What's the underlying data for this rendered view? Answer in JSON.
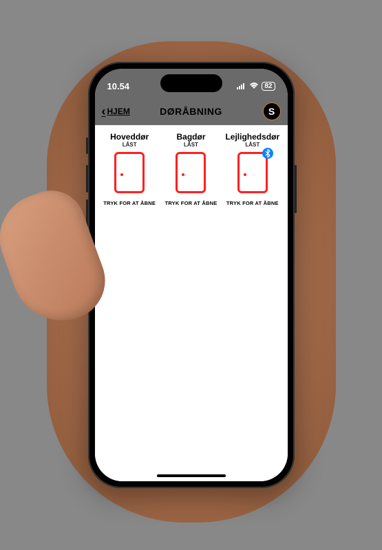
{
  "statusBar": {
    "time": "10.54",
    "battery": "82"
  },
  "nav": {
    "backLabel": "HJEM",
    "title": "DØRÅBNING",
    "logoLetter": "S"
  },
  "doors": [
    {
      "name": "Hoveddør",
      "status": "LÅST",
      "action": "TRYK FOR AT ÅBNE",
      "bluetooth": false
    },
    {
      "name": "Bagdør",
      "status": "LÅST",
      "action": "TRYK FOR AT ÅBNE",
      "bluetooth": false
    },
    {
      "name": "Lejlighedsdør",
      "status": "LÅST",
      "action": "TRYK FOR AT ÅBNE",
      "bluetooth": true
    }
  ],
  "colors": {
    "doorLocked": "#ff2020",
    "navBg": "#6a6a6a",
    "bluetooth": "#0a84ff"
  }
}
